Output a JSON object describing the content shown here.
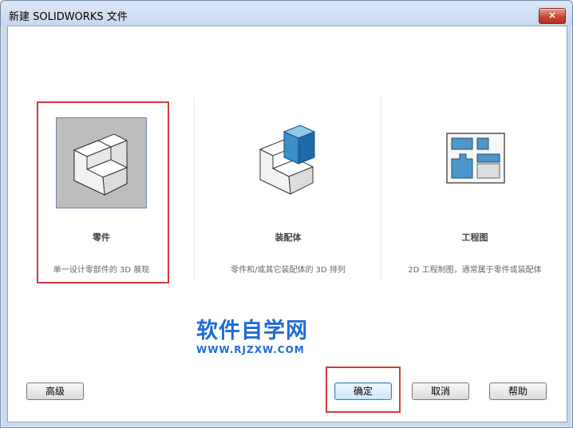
{
  "window": {
    "title": "新建 SOLIDWORKS 文件",
    "close_label": "×"
  },
  "templates": [
    {
      "label": "零件",
      "description": "单一设计零部件的 3D 展现",
      "icon": "part-icon",
      "selected": true
    },
    {
      "label": "装配体",
      "description": "零件和/或其它装配体的 3D 排列",
      "icon": "assembly-icon",
      "selected": false
    },
    {
      "label": "工程图",
      "description": "2D 工程制图，通常属于零件或装配体",
      "icon": "drawing-icon",
      "selected": false
    }
  ],
  "watermark": {
    "main": "软件自学网",
    "url": "WWW.RJZXW.COM"
  },
  "buttons": {
    "advanced": "高级",
    "ok": "确定",
    "cancel": "取消",
    "help": "帮助"
  },
  "colors": {
    "accent": "#1f6bd6",
    "highlight": "#d33b3b",
    "selection_bg": "#bdbdbd"
  }
}
